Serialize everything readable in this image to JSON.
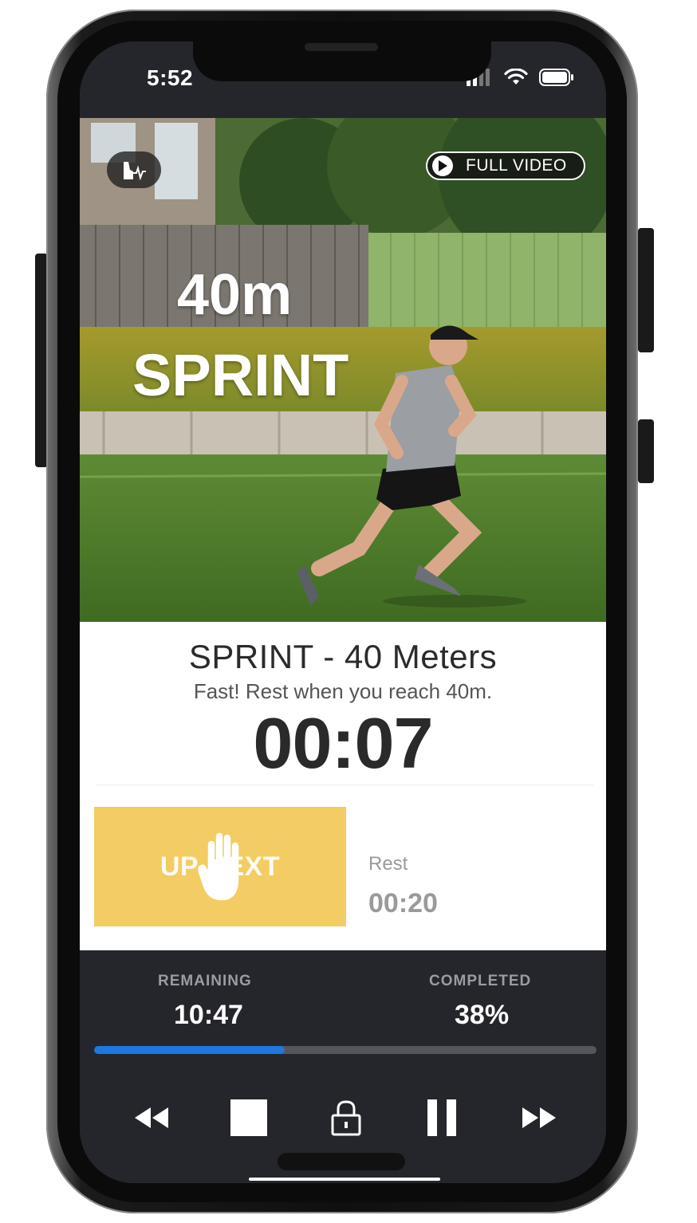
{
  "status_bar": {
    "time": "5:52"
  },
  "hero": {
    "title_line1": "40m",
    "title_line2": "SPRINT",
    "full_video_label": "FULL VIDEO"
  },
  "exercise": {
    "title": "SPRINT - 40 Meters",
    "subtitle": "Fast! Rest when you reach 40m.",
    "timer": "00:07"
  },
  "up_next": {
    "label": "UP NEXT",
    "name": "Rest",
    "duration": "00:20"
  },
  "stats": {
    "remaining_label": "REMAINING",
    "remaining_value": "10:47",
    "completed_label": "COMPLETED",
    "completed_value": "38%",
    "progress_fraction": 0.38
  },
  "controls": [
    "rewind-icon",
    "stop-icon",
    "lock-icon",
    "pause-icon",
    "fast-forward-icon"
  ],
  "colors": {
    "accent_blue": "#1f77e0",
    "up_next_yellow": "#f3cc63",
    "panel_dark": "#25262b"
  }
}
